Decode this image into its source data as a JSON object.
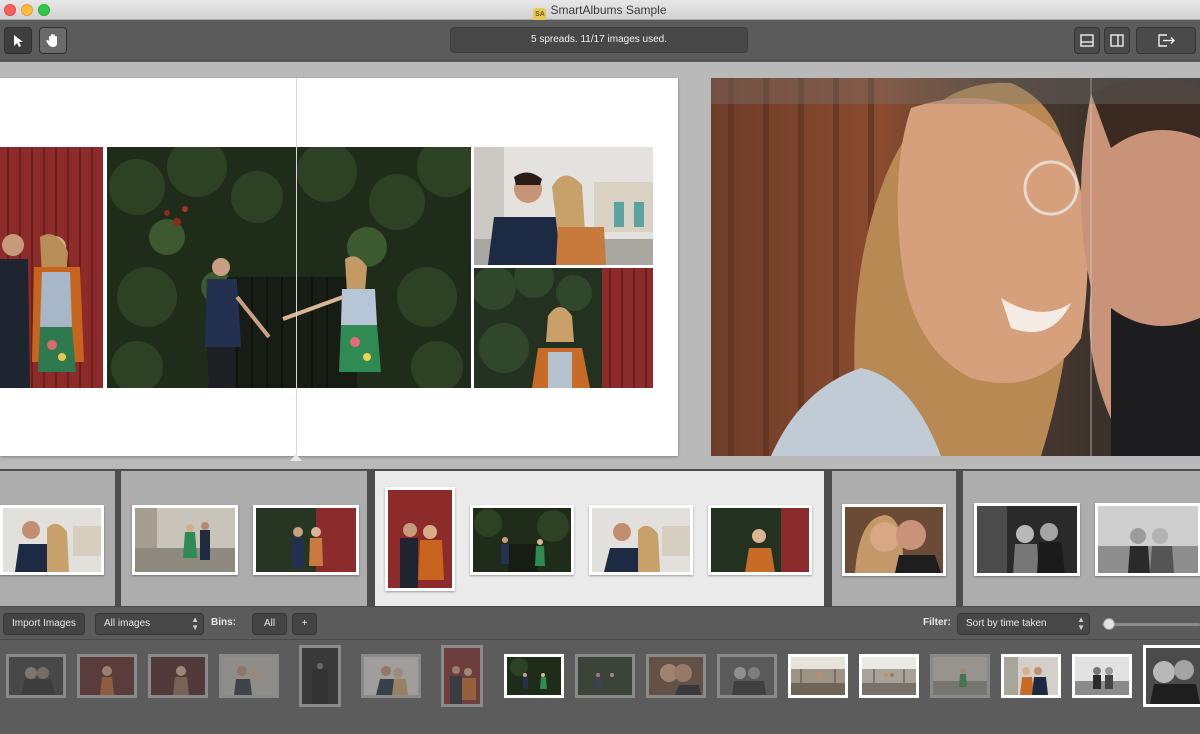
{
  "window": {
    "title": "SmartAlbums Sample",
    "app_icon_text": "SA"
  },
  "toolbar": {
    "select_tool_icon": "arrow-cursor-icon",
    "pan_tool_icon": "hand-icon",
    "status": "5 spreads. 11/17 images used.",
    "view_icons": [
      "single-view-icon",
      "split-view-icon",
      "export-icon"
    ]
  },
  "bottom_bar": {
    "import_label": "Import Images",
    "source_select": "All images",
    "bins_label": "Bins:",
    "bins_all": "All",
    "bins_add": "+",
    "filter_label": "Filter:",
    "sort_select": "Sort by time taken",
    "zoom_level": 0.05
  },
  "colors": {
    "accent_traffic_close": "#fc605c",
    "accent_traffic_min": "#fdbc40",
    "accent_traffic_max": "#34c84a",
    "canvas_bg": "#b9b9b9",
    "strip_active": "#ebebeb"
  }
}
